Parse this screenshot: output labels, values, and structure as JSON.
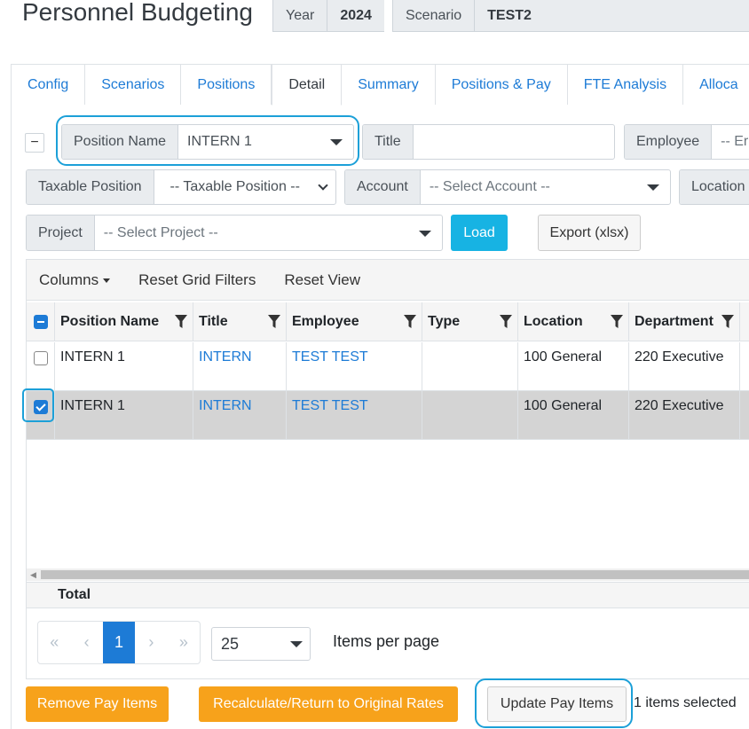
{
  "header": {
    "title": "Personnel Budgeting",
    "year_label": "Year",
    "year_value": "2024",
    "scenario_label": "Scenario",
    "scenario_value": "TEST2"
  },
  "tabs": [
    {
      "label": "Config"
    },
    {
      "label": "Scenarios"
    },
    {
      "label": "Positions"
    },
    {
      "label": "Detail",
      "active": true
    },
    {
      "label": "Summary"
    },
    {
      "label": "Positions & Pay"
    },
    {
      "label": "FTE Analysis"
    },
    {
      "label": "Alloca"
    }
  ],
  "filters": {
    "collapse_symbol": "−",
    "position_name": {
      "label": "Position Name",
      "value": "INTERN 1"
    },
    "title": {
      "label": "Title",
      "value": ""
    },
    "employee": {
      "label": "Employee",
      "placeholder": "-- Er"
    },
    "taxable_position": {
      "label": "Taxable Position",
      "value": "-- Taxable Position --"
    },
    "account": {
      "label": "Account",
      "placeholder": "-- Select Account --"
    },
    "location": {
      "label": "Location"
    },
    "project": {
      "label": "Project",
      "placeholder": "-- Select Project --"
    },
    "load_label": "Load",
    "export_label": "Export (xlsx)"
  },
  "grid": {
    "toolbar": {
      "columns_label": "Columns",
      "reset_filters_label": "Reset Grid Filters",
      "reset_view_label": "Reset View"
    },
    "columns": [
      "Position Name",
      "Title",
      "Employee",
      "Type",
      "Location",
      "Department"
    ],
    "rows": [
      {
        "position_name": "INTERN 1",
        "title": "INTERN",
        "employee": "TEST TEST",
        "type": "",
        "location": "100 General",
        "department": "220 Executive",
        "selected": false
      },
      {
        "position_name": "INTERN 1",
        "title": "INTERN",
        "employee": "TEST TEST",
        "type": "",
        "location": "100 General",
        "department": "220 Executive",
        "selected": true
      }
    ],
    "total_label": "Total"
  },
  "pager": {
    "first": "«",
    "prev": "‹",
    "current_page": "1",
    "next": "›",
    "last": "»",
    "page_size": "25",
    "items_per_page_label": "Items per page"
  },
  "actions": {
    "remove_label": "Remove Pay Items",
    "recalc_label": "Recalculate/Return to Original Rates",
    "update_label": "Update Pay Items",
    "selected_count": "1 items selected"
  },
  "colors": {
    "accent": "#1d7bd6",
    "load": "#17b3e3",
    "orange": "#f7a21b",
    "highlight": "#1ca0d8"
  }
}
